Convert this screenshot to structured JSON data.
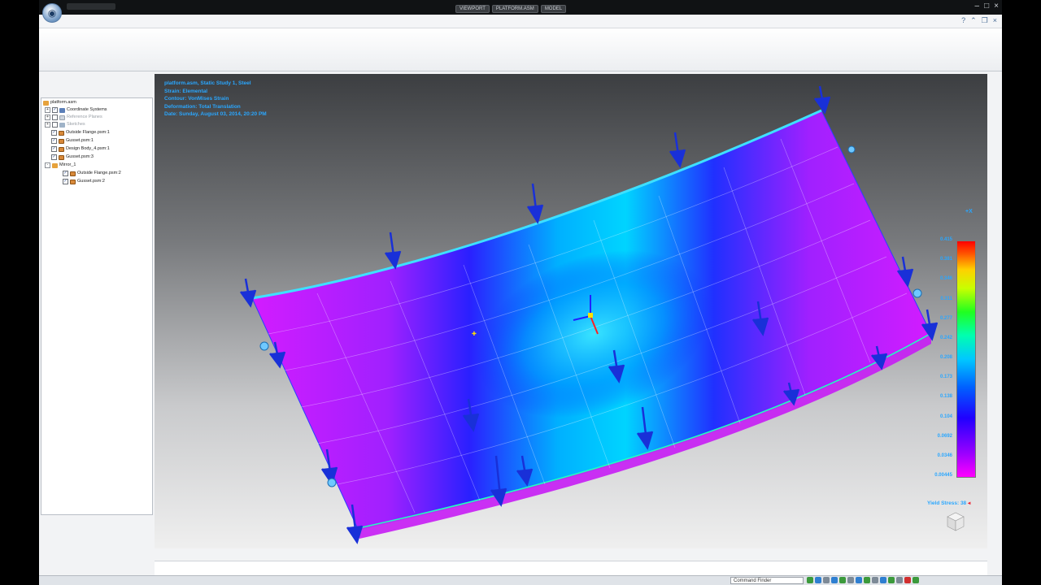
{
  "app": {
    "title_tabs": [
      "VIEWPORT",
      "PLATFORM.ASM",
      "MODEL"
    ],
    "window_controls": [
      "–",
      "□",
      "×"
    ]
  },
  "pathfinder": {
    "root": "platform.asm",
    "items": [
      {
        "label": "Coordinate Systems",
        "checked": true,
        "expander": "+",
        "icon": "coordinate-system-icon",
        "grayed": false
      },
      {
        "label": "Reference Planes",
        "checked": false,
        "expander": "+",
        "icon": "plane-icon",
        "grayed": true
      },
      {
        "label": "Sketches",
        "checked": false,
        "expander": "+",
        "icon": "sketch-icon",
        "grayed": true
      },
      {
        "label": "Outside Flange.psm:1",
        "checked": true,
        "icon": "part-icon"
      },
      {
        "label": "Gusset.psm:1",
        "checked": true,
        "icon": "part-icon"
      },
      {
        "label": "Design Body_4.psm:1",
        "checked": true,
        "icon": "part-icon"
      },
      {
        "label": "Gusset.psm:3",
        "checked": true,
        "icon": "part-icon"
      },
      {
        "label": "Mirror_1",
        "expander": "-",
        "icon": "assembly-icon"
      },
      {
        "label": "Outside Flange.psm:2",
        "checked": true,
        "icon": "part-icon",
        "indent": 1
      },
      {
        "label": "Gusset.psm:2",
        "checked": true,
        "icon": "part-icon",
        "indent": 1
      }
    ]
  },
  "viewport": {
    "info": [
      "platform.asm, Static Study 1, Steel",
      "Strain: Elemental",
      "Contour: VonMises Strain",
      "Deformation: Total Translation",
      "Date: Sunday, August 03, 2014, 20:20 PM"
    ],
    "legend": {
      "values": [
        "0.415",
        "0.381",
        "0.346",
        "0.311",
        "0.277",
        "0.242",
        "0.208",
        "0.173",
        "0.138",
        "0.104",
        "0.0692",
        "0.0346",
        "0.00445"
      ],
      "colors": [
        "#ff00ff",
        "#9a00ff",
        "#2000ff",
        "#0060ff",
        "#00c8ff",
        "#00ffb0",
        "#20ff20",
        "#c8ff00",
        "#ffd000",
        "#ff5000",
        "#ff0000"
      ]
    },
    "yield_stress_label": "Yield Stress: 38",
    "orientation_mark": "+X"
  },
  "statusbar": {
    "command_finder_placeholder": "Command Finder",
    "icon_colors": [
      "#3c9a3c",
      "#2f7fd1",
      "#7d8a97",
      "#2f7fd1",
      "#3c9a3c",
      "#7d8a97",
      "#2f7fd1",
      "#3c9a3c",
      "#7d8a97",
      "#2f7fd1",
      "#3c9a3c",
      "#7d8a97",
      "#d12f2f",
      "#3c9a3c"
    ]
  }
}
